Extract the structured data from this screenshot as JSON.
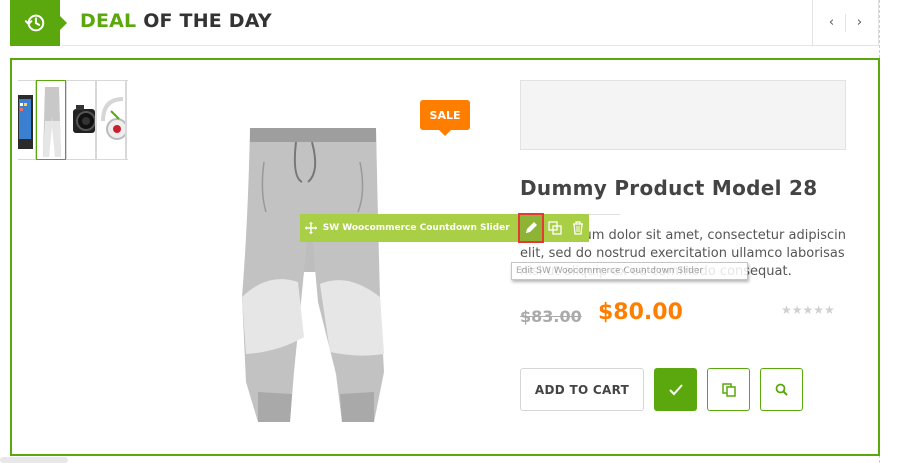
{
  "header": {
    "title_accent": "DEAL",
    "title_rest": " OF THE DAY",
    "icon": "history-icon",
    "nav": {
      "prev_icon": "chevron-left-icon",
      "next_icon": "chevron-right-icon",
      "prev_glyph": "‹",
      "next_glyph": "›"
    }
  },
  "colors": {
    "accent": "#5aa70e",
    "sale": "#ff7e00",
    "edit_bar": "#a8cf45",
    "highlight": "#e53935"
  },
  "product": {
    "badge": "SALE",
    "title": "Dummy Product Model 28",
    "description": "Lorem ipsum dolor sit amet, consectetur adipiscin elit, sed do nostrud exercitation ullamco laborisas nisi ut aliquip ex ea commodo consequat.",
    "price_old": "$83.00",
    "price_new": "$80.00",
    "rating": 0,
    "stars": "★★★★★"
  },
  "thumbnails": [
    {
      "name": "thumb-phone"
    },
    {
      "name": "thumb-pants"
    },
    {
      "name": "thumb-camera"
    },
    {
      "name": "thumb-headphones"
    },
    {
      "name": "thumb-headphones-2"
    }
  ],
  "edit_toolbar": {
    "label": "SW Woocommerce Countdown Slider",
    "tooltip": "Edit SW Woocommerce Countdown Slider"
  },
  "actions": {
    "add_to_cart": "ADD TO CART",
    "check_icon": "check-icon",
    "compare_icon": "copy-icon",
    "view_icon": "search-icon"
  }
}
